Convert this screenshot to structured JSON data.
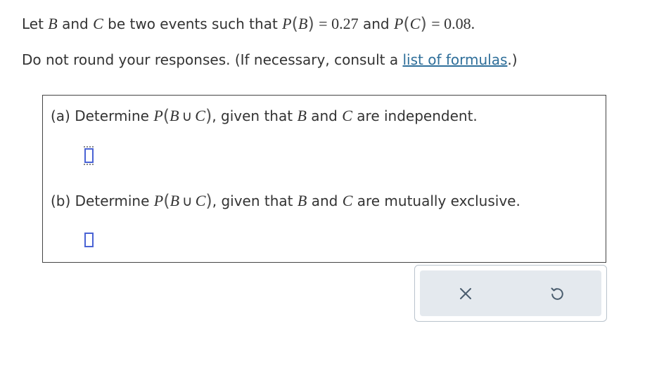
{
  "intro": {
    "let": "Let",
    "B": "B",
    "and1": "and",
    "C": "C",
    "rest": "be two events such that",
    "P": "P",
    "B2": "B",
    "eq_b": "= 0.27",
    "and2": "and",
    "P2": "P",
    "C2": "C",
    "eq_c": "= 0.08."
  },
  "instructions": {
    "text_before": "Do not round your responses. (If necessary, consult a ",
    "link": "list of formulas",
    "text_after": ".)"
  },
  "part_a": {
    "label": "(a) Determine",
    "P": "P",
    "B": "B",
    "cup": "∪",
    "C": "C",
    "given": ", given that",
    "B2": "B",
    "and": "and",
    "C2": "C",
    "tail": "are independent.",
    "answer_value": ""
  },
  "part_b": {
    "label": "(b) Determine",
    "P": "P",
    "B": "B",
    "cup": "∪",
    "C": "C",
    "given": ", given that",
    "B2": "B",
    "and": "and",
    "C2": "C",
    "tail": "are mutually exclusive.",
    "answer_value": ""
  },
  "toolbar": {
    "clear_icon": "close-icon",
    "undo_icon": "undo-icon"
  },
  "colors": {
    "accent": "#4a63d4",
    "link": "#2f6f9a",
    "toolbar_bg": "#e4e9ee",
    "icon": "#4a5d6e"
  }
}
